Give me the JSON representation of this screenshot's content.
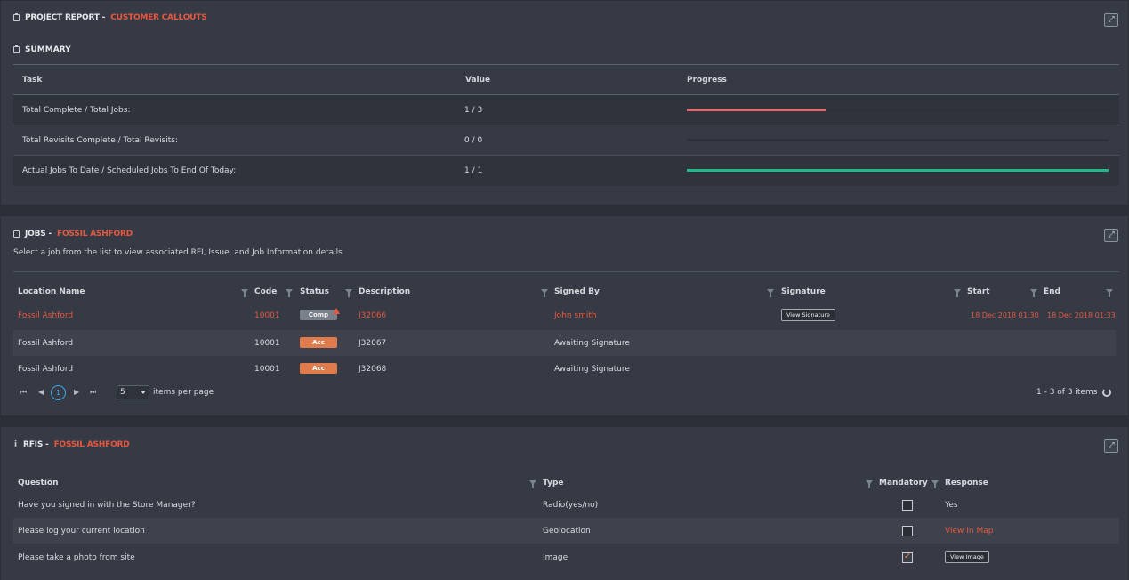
{
  "report": {
    "title": "PROJECT REPORT -",
    "accent": "CUSTOMER CALLOUTS",
    "expand_icon": "expand-icon",
    "summary_title": "SUMMARY",
    "headers": {
      "task": "Task",
      "value": "Value",
      "progress": "Progress"
    },
    "rows": [
      {
        "task": "Total Complete / Total Jobs:",
        "value": "1 / 3",
        "progress": 0.33,
        "color": "#e06a6e"
      },
      {
        "task": "Total Revisits Complete / Total Revisits:",
        "value": "0 / 0",
        "progress": 0,
        "color": "#e06a6e"
      },
      {
        "task": "Actual Jobs To Date / Scheduled Jobs To End Of Today:",
        "value": "1 / 1",
        "progress": 1,
        "color": "#21b88a"
      }
    ]
  },
  "jobs": {
    "title": "JOBS -",
    "accent": "FOSSIL ASHFORD",
    "description": "Select a job from the list to view associated RFI, Issue, and Job Information details",
    "columns": {
      "location": "Location Name",
      "code": "Code",
      "status": "Status",
      "description": "Description",
      "signed_by": "Signed By",
      "signature": "Signature",
      "start": "Start",
      "end": "End"
    },
    "rows": [
      {
        "location": "Fossil Ashford",
        "code": "10001",
        "status": "Comp",
        "description": "J32066",
        "signed_by": "John smith",
        "signature": "View Signature",
        "start": "18 Dec 2018 01:30",
        "end": "18 Dec 2018 01:33"
      },
      {
        "location": "Fossil Ashford",
        "code": "10001",
        "status": "Acc",
        "description": "J32067",
        "signed_by": "Awaiting Signature",
        "signature": "",
        "start": "",
        "end": ""
      },
      {
        "location": "Fossil Ashford",
        "code": "10001",
        "status": "Acc",
        "description": "J32068",
        "signed_by": "Awaiting Signature",
        "signature": "",
        "start": "",
        "end": ""
      }
    ],
    "pager": {
      "current_page": "1",
      "page_size": "5",
      "items_per_page_label": "items per page",
      "range_label": "1 - 3 of 3 items"
    }
  },
  "rfis": {
    "title": "RFIS -",
    "accent": "FOSSIL ASHFORD",
    "columns": {
      "question": "Question",
      "type": "Type",
      "mandatory": "Mandatory",
      "response": "Response"
    },
    "rows": [
      {
        "question": "Have you signed in with the Store Manager?",
        "type": "Radio(yes/no)",
        "mandatory": false,
        "response": "Yes"
      },
      {
        "question": "Please log your current location",
        "type": "Geolocation",
        "mandatory": false,
        "response": "View In Map"
      },
      {
        "question": "Please take a photo from site",
        "type": "Image",
        "mandatory": true,
        "response": "View Image"
      }
    ]
  },
  "colors": {
    "accent": "#e8573f",
    "success": "#21b88a",
    "danger": "#e06a6e",
    "badge_acc": "#e07b4e",
    "link": "#3ba7e0"
  }
}
